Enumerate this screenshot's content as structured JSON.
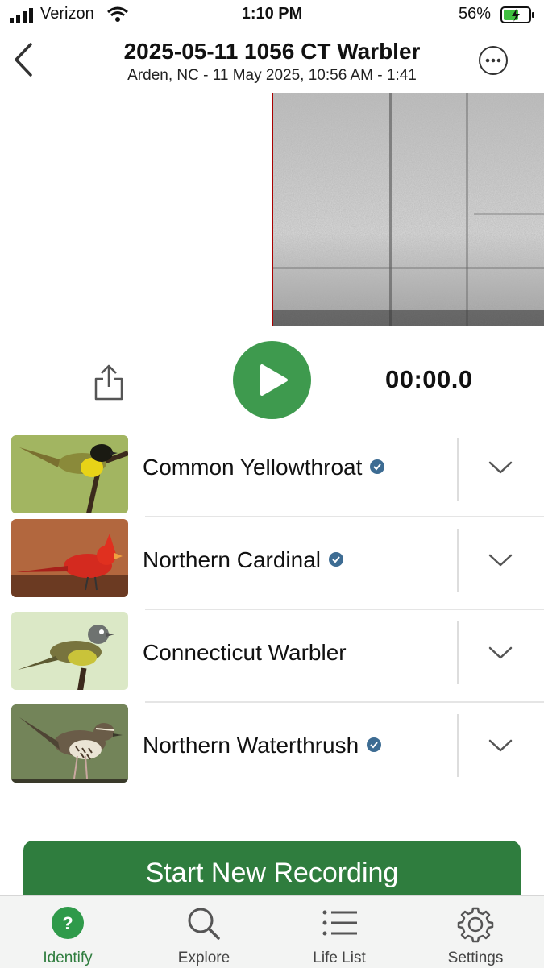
{
  "status": {
    "carrier": "Verizon",
    "time": "1:10 PM",
    "battery": "56%"
  },
  "header": {
    "title": "2025-05-11 1056 CT Warbler",
    "subtitle": "Arden, NC - 11 May 2025, 10:56 AM - 1:41"
  },
  "player": {
    "timer": "00:00.0"
  },
  "species": [
    {
      "name": "Common Yellowthroat",
      "verified": true
    },
    {
      "name": "Northern Cardinal",
      "verified": true
    },
    {
      "name": "Connecticut Warbler",
      "verified": false
    },
    {
      "name": "Northern Waterthrush",
      "verified": true
    }
  ],
  "cta": {
    "label": "Start New Recording"
  },
  "tabs": [
    {
      "label": "Identify",
      "icon": "question-circle-icon",
      "active": true
    },
    {
      "label": "Explore",
      "icon": "search-icon",
      "active": false
    },
    {
      "label": "Life List",
      "icon": "list-icon",
      "active": false
    },
    {
      "label": "Settings",
      "icon": "gear-icon",
      "active": false
    }
  ],
  "colors": {
    "accent": "#3e9a4e",
    "cta": "#2f7d3e",
    "active_tab": "#2f7d3e",
    "badge": "#3d6c93"
  }
}
